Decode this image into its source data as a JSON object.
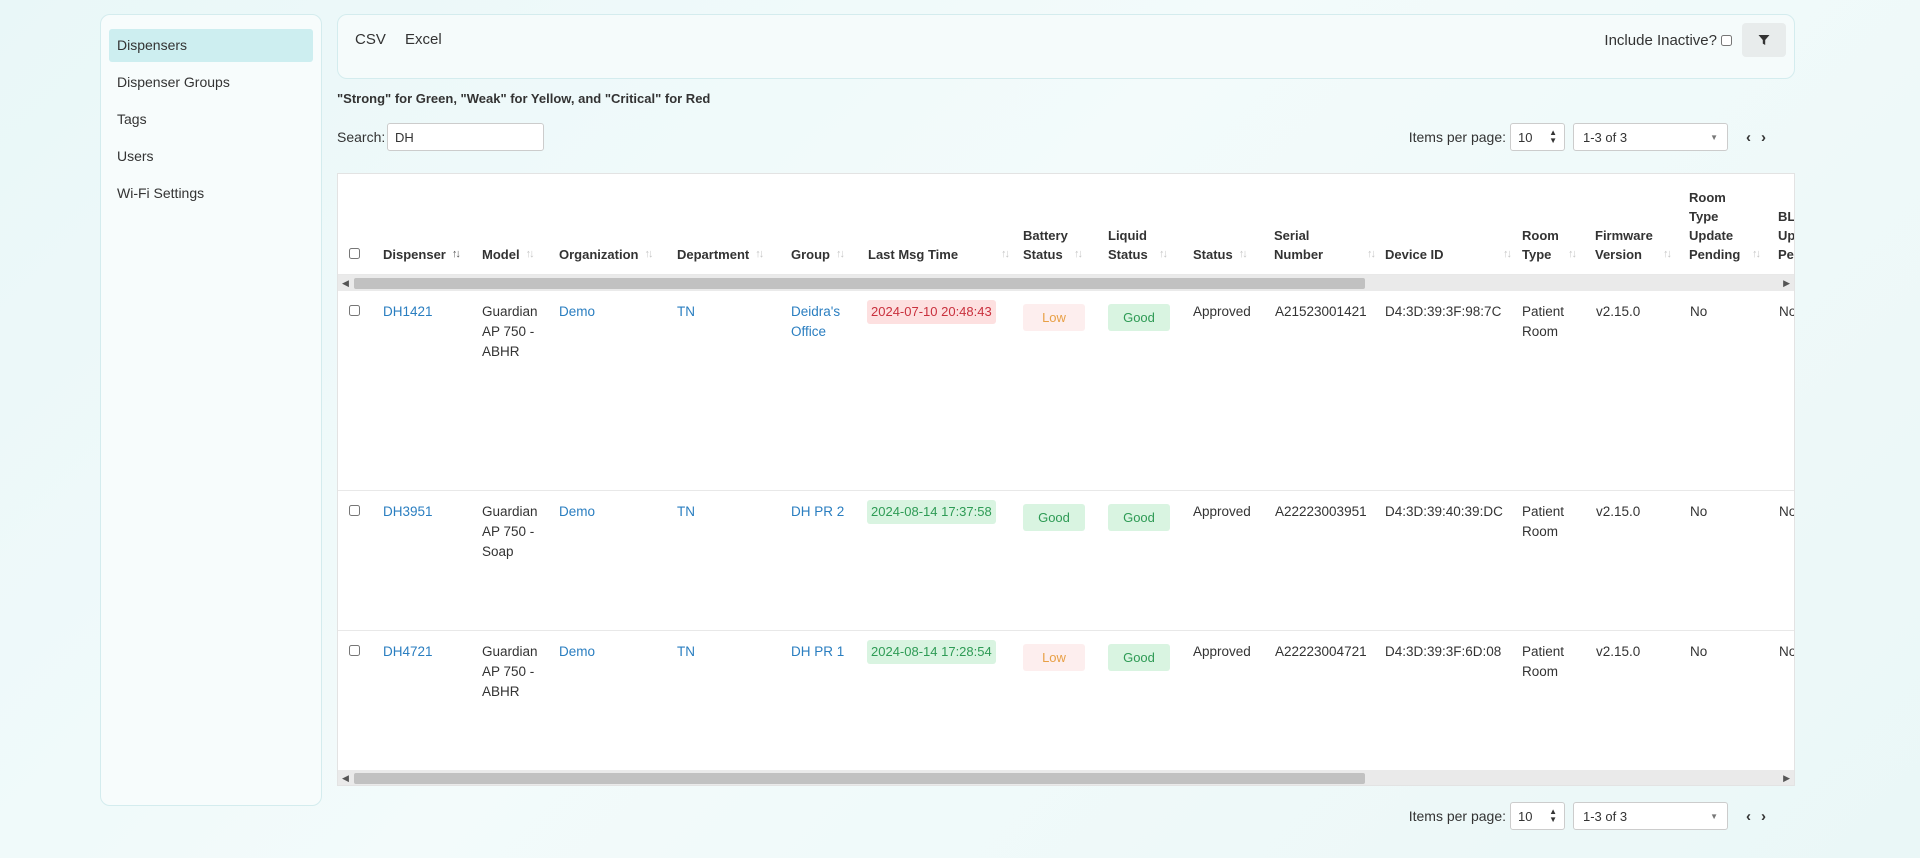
{
  "sidebar": {
    "items": [
      {
        "label": "Dispensers"
      },
      {
        "label": "Dispenser Groups"
      },
      {
        "label": "Tags"
      },
      {
        "label": "Users"
      },
      {
        "label": "Wi-Fi Settings"
      }
    ]
  },
  "toolbar": {
    "csv_label": "CSV",
    "excel_label": "Excel",
    "include_inactive_label": "Include Inactive?"
  },
  "note": "\"Strong\" for Green, \"Weak\" for Yellow, and \"Critical\" for Red",
  "search": {
    "label": "Search:",
    "value": "DH"
  },
  "pager": {
    "items_per_page_label": "Items per page:",
    "items_per_page": "10",
    "range": "1-3 of 3"
  },
  "table": {
    "columns": [
      {
        "label": "Dispenser",
        "sort": "↑↓"
      },
      {
        "label": "Model",
        "sort": "↑↓"
      },
      {
        "label": "Organization",
        "sort": "↑↓"
      },
      {
        "label": "Department",
        "sort": "↑↓"
      },
      {
        "label": "Group",
        "sort": "↑↓"
      },
      {
        "label": "Last Msg Time",
        "sort": "↑↓"
      },
      {
        "label": "Battery Status",
        "sort": "↑↓"
      },
      {
        "label": "Liquid Status",
        "sort": "↑↓"
      },
      {
        "label": "Status",
        "sort": "↑↓"
      },
      {
        "label": "Serial Number",
        "sort": "↑↓"
      },
      {
        "label": "Device ID",
        "sort": "↑↓"
      },
      {
        "label": "Room Type",
        "sort": "↑↓"
      },
      {
        "label": "Firmware Version",
        "sort": "↑↓"
      },
      {
        "label": "Room Type Update Pending",
        "sort": "↑↓"
      },
      {
        "label": "BLE Update Pending",
        "sort": ""
      }
    ],
    "rows": [
      {
        "dispenser": "DH1421",
        "model": "Guardian AP 750 - ABHR",
        "organization": "Demo",
        "department": "TN",
        "group": "Deidra's Office",
        "last_msg": "2024-07-10 20:48:43",
        "battery": "Low",
        "liquid": "Good",
        "status": "Approved",
        "serial": "A21523001421",
        "device_id": "D4:3D:39:3F:98:7C",
        "room_type": "Patient Room",
        "firmware": "v2.15.0",
        "rt_pending": "No",
        "ble_pending": "No"
      },
      {
        "dispenser": "DH3951",
        "model": "Guardian AP 750 - Soap",
        "organization": "Demo",
        "department": "TN",
        "group": "DH PR 2",
        "last_msg": "2024-08-14 17:37:58",
        "battery": "Good",
        "liquid": "Good",
        "status": "Approved",
        "serial": "A22223003951",
        "device_id": "D4:3D:39:40:39:DC",
        "room_type": "Patient Room",
        "firmware": "v2.15.0",
        "rt_pending": "No",
        "ble_pending": "No"
      },
      {
        "dispenser": "DH4721",
        "model": "Guardian AP 750 - ABHR",
        "organization": "Demo",
        "department": "TN",
        "group": "DH PR 1",
        "last_msg": "2024-08-14 17:28:54",
        "battery": "Low",
        "liquid": "Good",
        "status": "Approved",
        "serial": "A22223004721",
        "device_id": "D4:3D:39:3F:6D:08",
        "room_type": "Patient Room",
        "firmware": "v2.15.0",
        "rt_pending": "No",
        "ble_pending": "No"
      }
    ]
  },
  "colors": {
    "accent": "#2a7ec0",
    "sidebar_active": "#cdeef0",
    "status_red_bg": "#fde0e0",
    "status_green_bg": "#d9f4e1",
    "low_text": "#e8a046"
  }
}
